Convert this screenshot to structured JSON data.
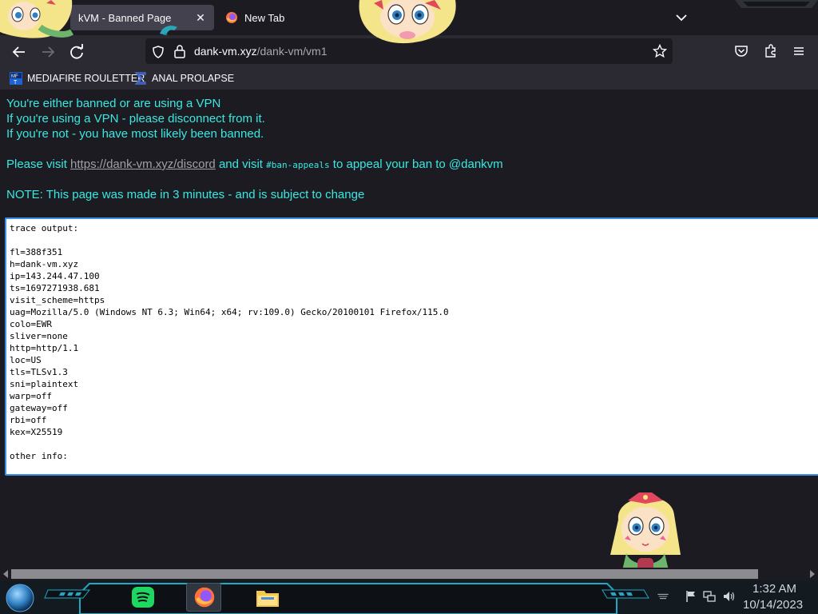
{
  "tabs": [
    {
      "title": "kVM - Banned Page",
      "active": true
    },
    {
      "title": "New Tab",
      "active": false
    }
  ],
  "toolbar": {
    "url_domain": "dank-vm.xyz",
    "url_path": "/dank-vm/vm1"
  },
  "bookmarks": [
    {
      "label": "MEDIAFIRE ROULETTER",
      "icon": "mediafire-icon"
    },
    {
      "label": "ANAL PROLAPSE",
      "icon": "sigma-icon"
    }
  ],
  "page": {
    "line1": "You're either banned or are using a VPN",
    "line2": "If you're using a VPN - please disconnect from it.",
    "line3": "If you're not - you have most likely been banned.",
    "visit_prefix": "Please visit ",
    "discord_link": "https://dank-vm.xyz/discord",
    "visit_mid": " and visit ",
    "channel": "#ban-appeals",
    "visit_suffix": " to appeal your ban to @dankvm",
    "note": "NOTE: This page was made in 3 minutes - and is subject to change",
    "trace": "trace output:\n\nfl=388f351\nh=dank-vm.xyz\nip=143.244.47.100\nts=1697271938.681\nvisit_scheme=https\nuag=Mozilla/5.0 (Windows NT 6.3; Win64; x64; rv:109.0) Gecko/20100101 Firefox/115.0\ncolo=EWR\nsliver=none\nhttp=http/1.1\nloc=US\ntls=TLSv1.3\nsni=plaintext\nwarp=off\ngateway=off\nrbi=off\nkex=X25519\n\nother info:"
  },
  "taskbar": {
    "time": "1:32 AM",
    "date": "10/14/2023",
    "apps": [
      "spotify-icon",
      "firefox-icon",
      "file-explorer-icon"
    ],
    "accent_color": "#1da9c7"
  },
  "colors": {
    "page_text": "#3ae8e1",
    "page_bg": "#1c1b22",
    "trace_border": "#3b8ee8"
  }
}
